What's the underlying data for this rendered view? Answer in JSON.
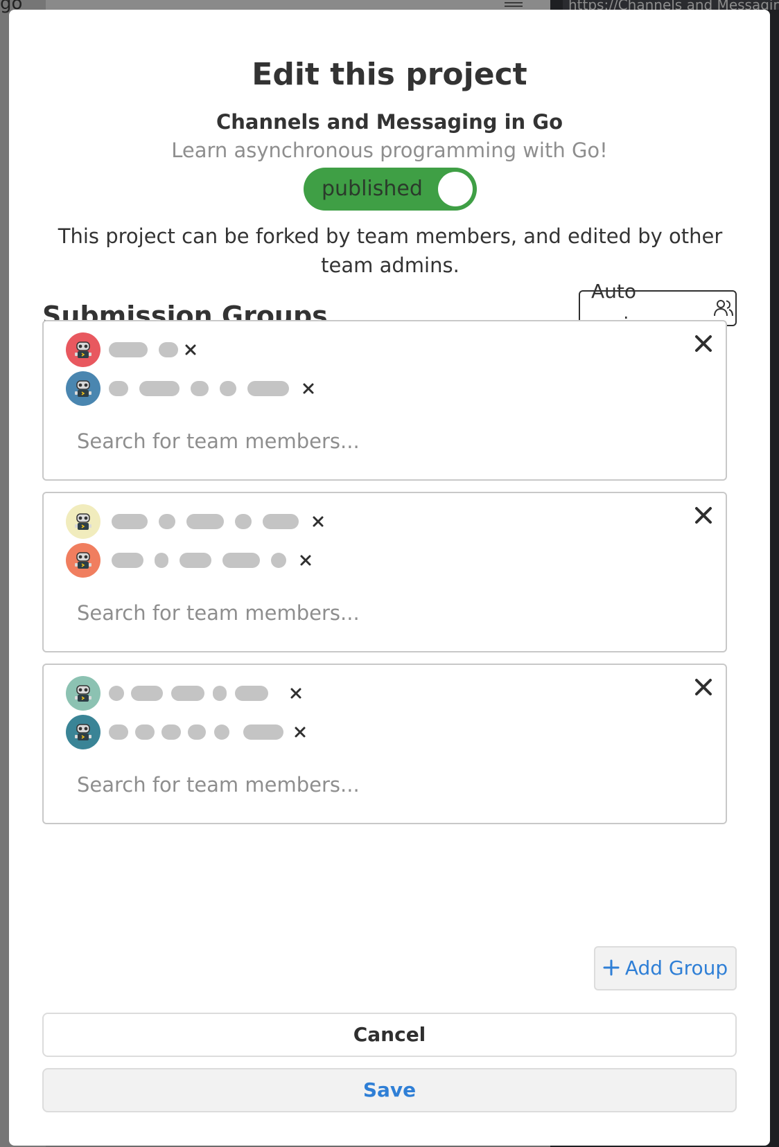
{
  "background": {
    "left_text": "go",
    "right_text": "https://Channels and Messaging"
  },
  "modal": {
    "title": "Edit this project",
    "project_name": "Channels and Messaging in Go",
    "project_description": "Learn asynchronous programming with Go!",
    "publish_toggle": {
      "label": "published",
      "state": "on",
      "color": "#3f9f45"
    },
    "publish_note": "This project can be forked by team members, and edited by other team admins.",
    "section_title": "Submission Groups",
    "auto_assign_label": "Auto assign",
    "auto_assign_icon": "users-icon",
    "search_placeholder": "Search for team members...",
    "groups": [
      {
        "members": [
          {
            "avatar_color": "#e8585f",
            "avatar_icon": "robot-icon",
            "name": "redacted"
          },
          {
            "avatar_color": "#4a86b0",
            "avatar_icon": "robot-icon",
            "name": "redacted"
          }
        ]
      },
      {
        "members": [
          {
            "avatar_color": "#f1ecbd",
            "avatar_icon": "robot-icon",
            "name": "redacted"
          },
          {
            "avatar_color": "#f07e5f",
            "avatar_icon": "robot-icon",
            "name": "redacted"
          }
        ]
      },
      {
        "members": [
          {
            "avatar_color": "#8cc2b2",
            "avatar_icon": "robot-icon",
            "name": "redacted"
          },
          {
            "avatar_color": "#3a8496",
            "avatar_icon": "robot-icon",
            "name": "redacted"
          }
        ]
      }
    ],
    "add_group_label": "Add Group",
    "cancel_label": "Cancel",
    "save_label": "Save",
    "accent_color": "#2f7fd6"
  }
}
